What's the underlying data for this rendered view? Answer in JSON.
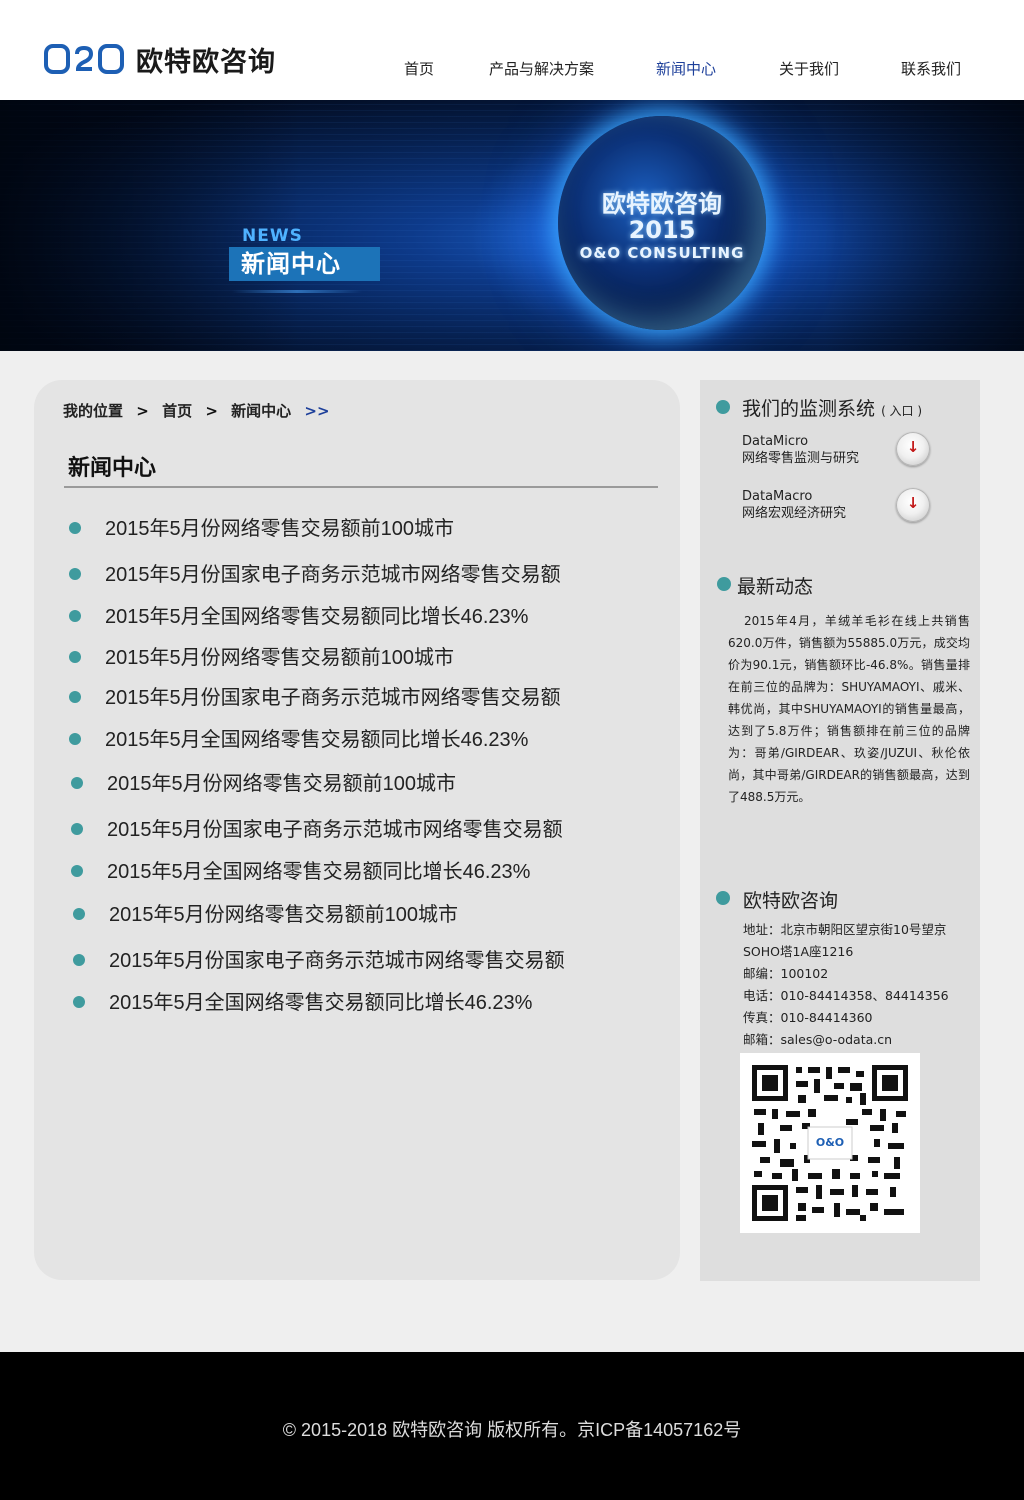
{
  "brand": {
    "logo_mark": "O&O",
    "name": "欧特欧咨询",
    "accent_color": "#1d5fb4"
  },
  "nav": {
    "items": [
      {
        "label": "首页",
        "active": false
      },
      {
        "label": "产品与解决方案",
        "active": false
      },
      {
        "label": "新闻中心",
        "active": true
      },
      {
        "label": "关于我们",
        "active": false
      },
      {
        "label": "联系我们",
        "active": false
      }
    ]
  },
  "banner": {
    "news_en": "NEWS",
    "news_zh": "新闻中心",
    "globe_line1": "欧特欧咨询",
    "globe_line2": "2015",
    "globe_line3": "O&O CONSULTING"
  },
  "breadcrumb": {
    "label": "我的位置",
    "sep": ">",
    "home": "首页",
    "current": "新闻中心",
    "tail": ">>"
  },
  "main": {
    "title": "新闻中心",
    "bullet_color": "#3f9b9e",
    "news": [
      "2015年5月份网络零售交易额前100城市",
      "2015年5月份国家电子商务示范城市网络零售交易额",
      "2015年5月全国网络零售交易额同比增长46.23%",
      "2015年5月份网络零售交易额前100城市",
      "2015年5月份国家电子商务示范城市网络零售交易额",
      "2015年5月全国网络零售交易额同比增长46.23%",
      "2015年5月份网络零售交易额前100城市",
      "2015年5月份国家电子商务示范城市网络零售交易额",
      "2015年5月全国网络零售交易额同比增长46.23%",
      "2015年5月份网络零售交易额前100城市",
      "2015年5月份国家电子商务示范城市网络零售交易额",
      "2015年5月全国网络零售交易额同比增长46.23%"
    ]
  },
  "sidebar": {
    "monitor": {
      "title": "我们的监测系统",
      "suffix": "( 入口 )",
      "systems": [
        {
          "name": "DataMicro",
          "desc": "网络零售监测与研究",
          "button_icon": "down-arrow-icon"
        },
        {
          "name": "DataMacro",
          "desc": "网络宏观经济研究",
          "button_icon": "down-arrow-icon"
        }
      ]
    },
    "latest": {
      "title": "最新动态",
      "text": "2015年4月，羊绒羊毛衫在线上共销售620.0万件，销售额为55885.0万元，成交均价为90.1元，销售额环比-46.8%。销售量排在前三位的品牌为：SHUYAMAOYI、戚米、韩优尚，其中SHUYAMAOYI的销售量最高，达到了5.8万件；销售额排在前三位的品牌为：哥弟/GIRDEAR、玖姿/JUZUI、秋伦依尚，其中哥弟/GIRDEAR的销售额最高，达到了488.5万元。"
    },
    "company": {
      "title": "欧特欧咨询",
      "address1": "地址：北京市朝阳区望京街10号望京",
      "address2": "SOHO塔1A座1216",
      "postcode": "邮编：100102",
      "phone": "电话：010-84414358、84414356",
      "fax": "传真：010-84414360",
      "email": "邮箱：sales@o-odata.cn",
      "qr_caption": "O&O"
    }
  },
  "footer": {
    "text": "© 2015-2018 欧特欧咨询 版权所有。京ICP备14057162号"
  }
}
